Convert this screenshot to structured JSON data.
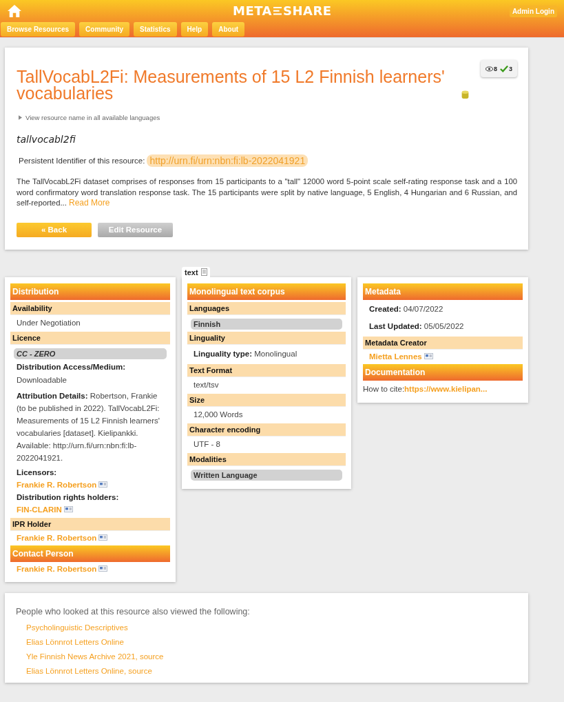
{
  "header": {
    "logo_left": "META",
    "logo_right": "SHARE",
    "admin_login": "Admin Login",
    "nav": [
      "Browse Resources",
      "Community",
      "Statistics",
      "Help",
      "About"
    ]
  },
  "resource": {
    "title": "TallVocabL2Fi: Measurements of 15 L2 Finnish learners' vocabularies",
    "views": "8",
    "downloads": "3",
    "names_toggle": "View resource name in all available languages",
    "short_name": "tallvocabl2fi",
    "pid_label": "Persistent Identifier of this resource:",
    "pid_url": "http://urn.fi/urn:nbn:fi:lb-2022041921",
    "description": "The TallVocabL2Fi dataset comprises of responses from 15 participants to a \"tall\" 12000 word 5-point scale self-rating response task and a 100 word confirmatory word translation response task. The 15 participants were split by native language, 5 English, 4 Hungarian and 6 Russian, and self-reported",
    "ellipsis": "...",
    "read_more": "Read More",
    "buttons": [
      {
        "label": "« Back",
        "disabled": false
      },
      {
        "label": "Edit Resource",
        "disabled": true
      }
    ]
  },
  "columns": [
    {
      "blocks": [
        {
          "kind": "header",
          "text": "Distribution"
        },
        {
          "kind": "sub",
          "text": "Availability"
        },
        {
          "kind": "value",
          "text": "Under Negotiation"
        },
        {
          "kind": "sub",
          "text": "Licence"
        },
        {
          "kind": "pill",
          "text": "CC - ZERO",
          "italic": true
        },
        {
          "kind": "label",
          "text": "Distribution Access/Medium:"
        },
        {
          "kind": "value",
          "text": "Downloadable"
        },
        {
          "kind": "field",
          "label": "Attribution Details:",
          "text": "Robertson, Frankie (to be published in 2022). TallVocabL2Fi: Measurements of 15 L2 Finnish learners' vocabularies [dataset]. Kielipankki. Available: http://urn.fi/urn:nbn:fi:lb-2022041921."
        },
        {
          "kind": "label",
          "text": "Licensors:"
        },
        {
          "kind": "link",
          "text": "Frankie R. Robertson"
        },
        {
          "kind": "label",
          "text": "Distribution rights holders:"
        },
        {
          "kind": "link",
          "text": "FIN-CLARIN"
        },
        {
          "kind": "sub",
          "text": "IPR Holder"
        },
        {
          "kind": "link",
          "text": "Frankie R. Robertson"
        },
        {
          "kind": "header",
          "text": "Contact Person"
        },
        {
          "kind": "link",
          "text": "Frankie R. Robertson"
        }
      ]
    },
    {
      "tab": "text",
      "blocks": [
        {
          "kind": "header",
          "text": "Monolingual text corpus"
        },
        {
          "kind": "sub",
          "text": "Languages"
        },
        {
          "kind": "pill",
          "text": "Finnish",
          "italic": false
        },
        {
          "kind": "sub",
          "text": "Linguality"
        },
        {
          "kind": "field",
          "label": "Linguality type:",
          "text": "Monolingual"
        },
        {
          "kind": "sub",
          "text": "Text Format"
        },
        {
          "kind": "value",
          "text": "text/tsv"
        },
        {
          "kind": "sub",
          "text": "Size"
        },
        {
          "kind": "value",
          "text": "12,000 Words"
        },
        {
          "kind": "sub",
          "text": "Character encoding"
        },
        {
          "kind": "value",
          "text": "UTF - 8"
        },
        {
          "kind": "sub",
          "text": "Modalities"
        },
        {
          "kind": "pill",
          "text": "Written Language",
          "italic": false
        }
      ]
    },
    {
      "blocks": [
        {
          "kind": "header",
          "text": "Metadata"
        },
        {
          "kind": "field",
          "label": "Created:",
          "text": "04/07/2022"
        },
        {
          "kind": "field",
          "label": "Last Updated:",
          "text": "05/05/2022"
        },
        {
          "kind": "sub",
          "text": "Metadata Creator"
        },
        {
          "kind": "link",
          "text": "Mietta Lennes"
        },
        {
          "kind": "header",
          "text": "Documentation"
        },
        {
          "kind": "cite",
          "label": "How to cite:",
          "text": "https://www.kielipan..."
        }
      ]
    }
  ],
  "also_viewed": {
    "intro": "People who looked at this resource also viewed the following:",
    "links": [
      "Psycholinguistic Descriptives",
      "Elias Lönnrot Letters Online",
      "Yle Finnish News Archive 2021, source",
      "Elias Lönnrot Letters Online, source"
    ]
  }
}
